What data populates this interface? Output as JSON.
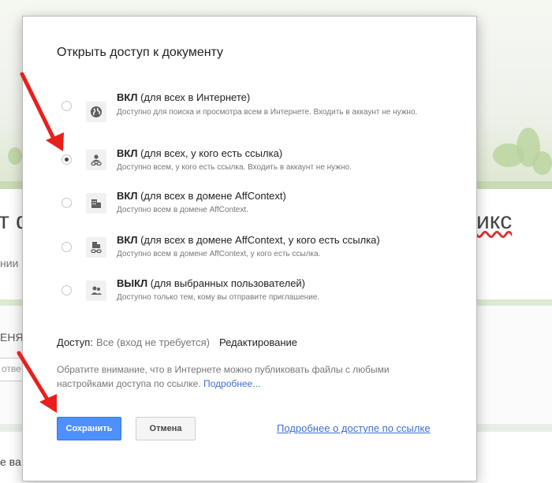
{
  "background": {
    "heading_left": "т ф",
    "heading_right": "икс",
    "text_left_1": "нии",
    "text_left_2": "ЕНЯ",
    "input_left": "отве",
    "text_left_3": "е ва"
  },
  "dialog": {
    "title": "Открыть доступ к документу",
    "options": [
      {
        "title_bold": "ВКЛ",
        "title_rest": " (для всех в Интернете)",
        "desc": "Доступно для поиска и просмотра всем в Интернете. Входить в аккаунт не нужно.",
        "icon": "globe-icon",
        "checked": false
      },
      {
        "title_bold": "ВКЛ",
        "title_rest": " (для всех, у кого есть ссылка)",
        "desc": "Доступно всем, у кого есть ссылка. Входить в аккаунт не нужно.",
        "icon": "link-person-icon",
        "checked": true
      },
      {
        "title_bold": "ВКЛ",
        "title_rest": " (для всех в домене AffContext)",
        "desc": "Доступно всем в домене AffContext.",
        "icon": "building-icon",
        "checked": false
      },
      {
        "title_bold": "ВКЛ",
        "title_rest": " (для всех в домене AffContext, у кого есть ссылка)",
        "desc": "Доступно всем в домене AffContext, у кого есть ссылка.",
        "icon": "building-link-icon",
        "checked": false
      },
      {
        "title_bold": "ВЫКЛ",
        "title_rest": " (для выбранных пользователей)",
        "desc": "Доступно только тем, кому вы отправите приглашение.",
        "icon": "people-icon",
        "checked": false
      }
    ],
    "access_label": "Доступ:",
    "access_value": "Все (вход не требуется)",
    "access_permission": "Редактирование",
    "note_text": "Обратите внимание, что в Интернете можно публиковать файлы с любыми настройками доступа по ссылке. ",
    "note_link": "Подробнее...",
    "save_label": "Сохранить",
    "cancel_label": "Отмена",
    "more_link": "Подробнее о доступе по ссылке"
  },
  "colors": {
    "accent": "#4d90fe",
    "link": "#3a6fd8",
    "arrow": "#e8201c"
  }
}
